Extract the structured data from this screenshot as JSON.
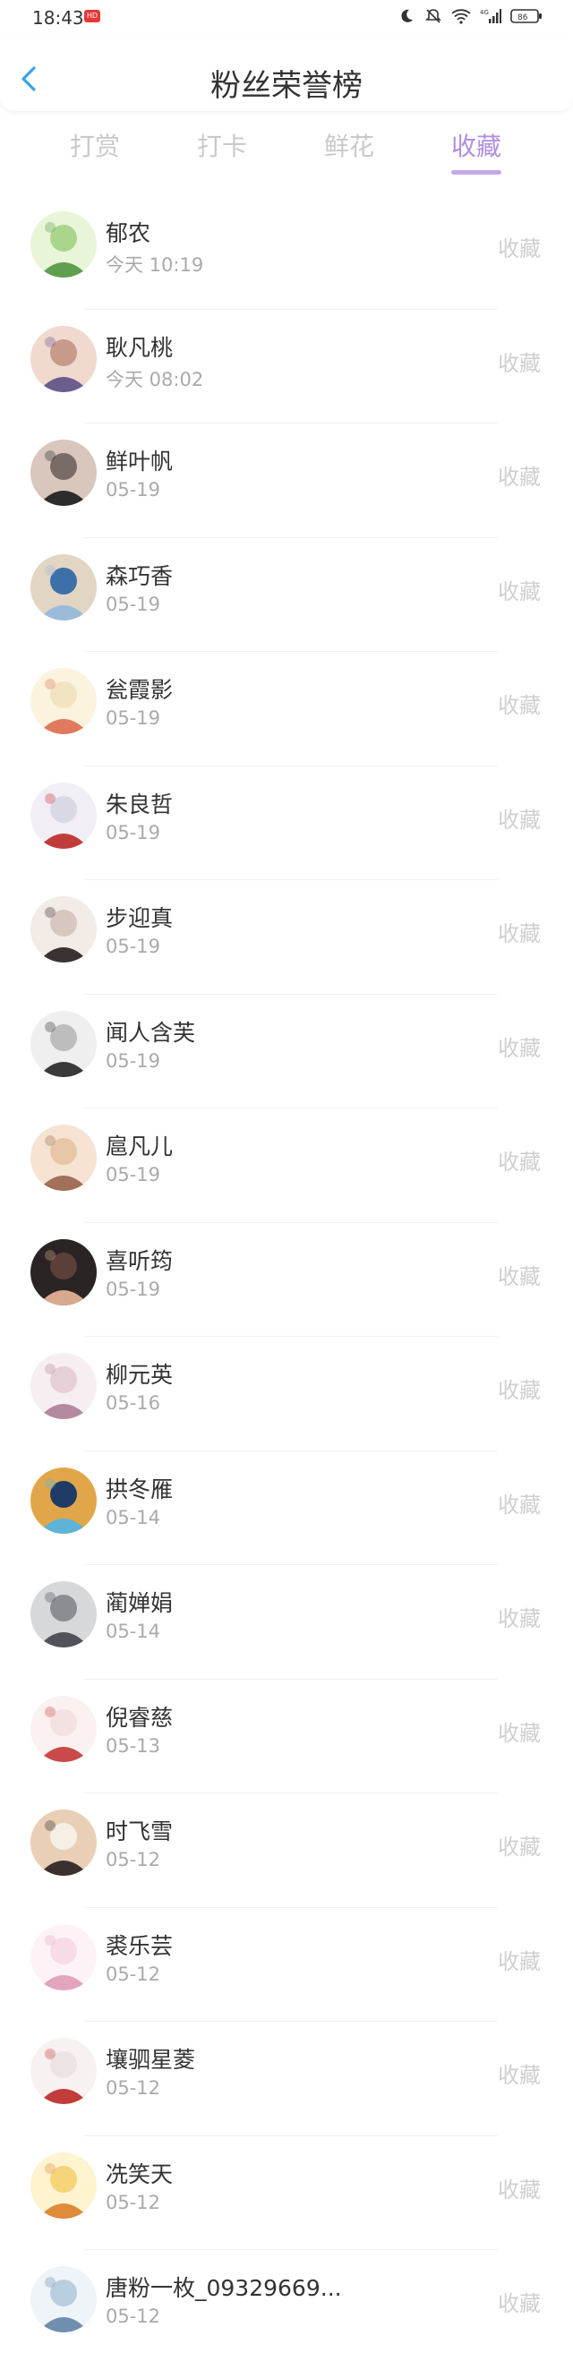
{
  "status_bar": {
    "time": "18:43",
    "badge": "HD",
    "network": "4G",
    "battery": "86"
  },
  "nav": {
    "title": "粉丝荣誉榜",
    "back_icon": "chevron-left-icon"
  },
  "tabs": [
    {
      "label": "打赏"
    },
    {
      "label": "打卡"
    },
    {
      "label": "鲜花"
    },
    {
      "label": "收藏"
    }
  ],
  "active_tab": 3,
  "colors": {
    "accent": "#b08ee0",
    "back_arrow": "#3aa3e3"
  },
  "fans": [
    {
      "name": "郁农",
      "date": "今天 10:19",
      "action": "收藏"
    },
    {
      "name": "耿凡桃",
      "date": "今天 08:02",
      "action": "收藏"
    },
    {
      "name": "鲜叶帆",
      "date": "05-19",
      "action": "收藏"
    },
    {
      "name": "森巧香",
      "date": "05-19",
      "action": "收藏"
    },
    {
      "name": "瓮霞影",
      "date": "05-19",
      "action": "收藏"
    },
    {
      "name": "朱良哲",
      "date": "05-19",
      "action": "收藏"
    },
    {
      "name": "步迎真",
      "date": "05-19",
      "action": "收藏"
    },
    {
      "name": "闻人含芙",
      "date": "05-19",
      "action": "收藏"
    },
    {
      "name": "扈凡儿",
      "date": "05-19",
      "action": "收藏"
    },
    {
      "name": "喜听筠",
      "date": "05-19",
      "action": "收藏"
    },
    {
      "name": "柳元英",
      "date": "05-16",
      "action": "收藏"
    },
    {
      "name": "拱冬雁",
      "date": "05-14",
      "action": "收藏"
    },
    {
      "name": "蔺婵娟",
      "date": "05-14",
      "action": "收藏"
    },
    {
      "name": "倪睿慈",
      "date": "05-13",
      "action": "收藏"
    },
    {
      "name": "时飞雪",
      "date": "05-12",
      "action": "收藏"
    },
    {
      "name": "裘乐芸",
      "date": "05-12",
      "action": "收藏"
    },
    {
      "name": "壤驷星菱",
      "date": "05-12",
      "action": "收藏"
    },
    {
      "name": "冼笑天",
      "date": "05-12",
      "action": "收藏"
    },
    {
      "name": "唐粉一枚_09329669...",
      "date": "05-12",
      "action": "收藏"
    }
  ]
}
